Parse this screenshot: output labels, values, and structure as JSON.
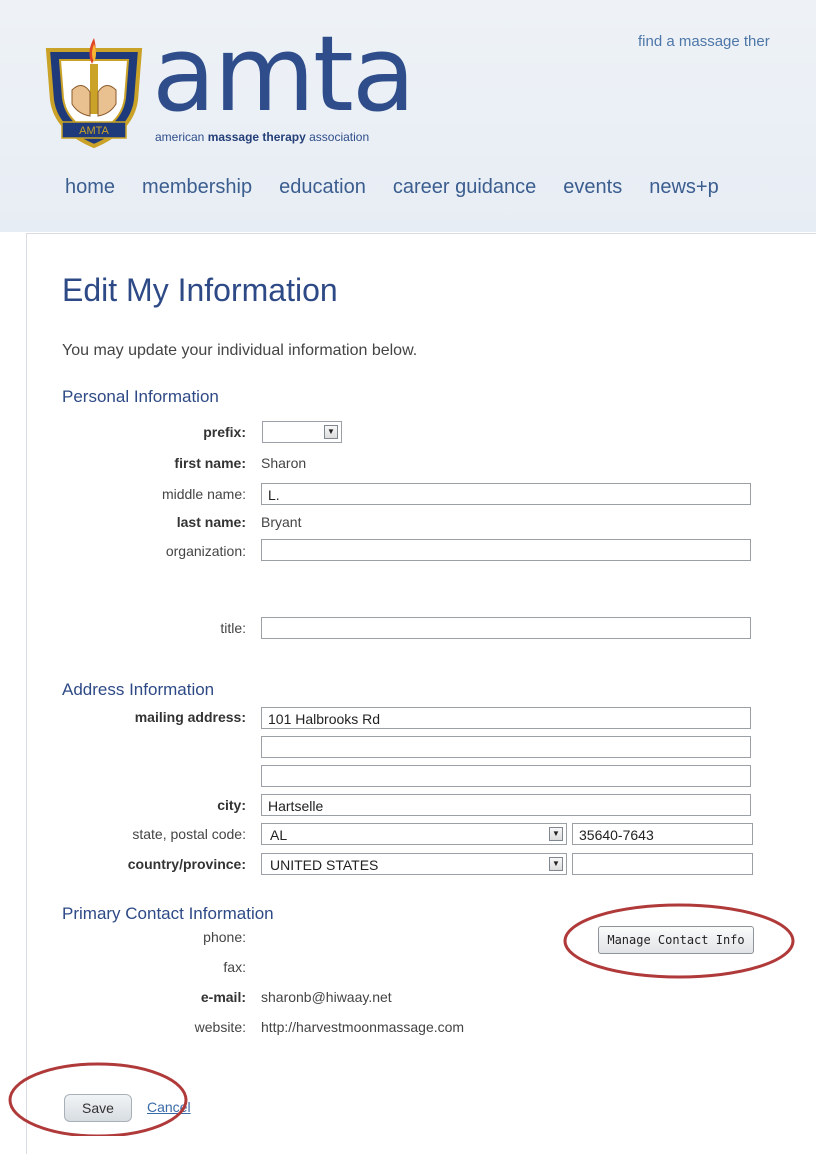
{
  "header": {
    "logo_word": "amta",
    "logo_tagline_pre": "american",
    "logo_tagline_bold": "massage therapy",
    "logo_tagline_post": "association",
    "emblem_text": "AMTA",
    "top_link": "find a massage ther",
    "nav": [
      "home",
      "membership",
      "education",
      "career guidance",
      "events",
      "news+p"
    ]
  },
  "page": {
    "title": "Edit My Information",
    "intro": "You may update your individual information below."
  },
  "personal": {
    "section_title": "Personal Information",
    "prefix_label": "prefix:",
    "prefix_value": "",
    "first_name_label": "first name:",
    "first_name_value": "Sharon",
    "middle_name_label": "middle name:",
    "middle_name_value": "L.",
    "last_name_label": "last name:",
    "last_name_value": "Bryant",
    "organization_label": "organization:",
    "organization_value": "",
    "title_label": "title:",
    "title_value": ""
  },
  "address": {
    "section_title": "Address Information",
    "mailing_label": "mailing address:",
    "line1": "101 Halbrooks Rd",
    "line2": "",
    "line3": "",
    "city_label": "city:",
    "city_value": "Hartselle",
    "state_label": "state, postal code:",
    "state_value": "AL",
    "postal_value": "35640-7643",
    "country_label": "country/province:",
    "country_value": "UNITED STATES",
    "province_value": ""
  },
  "contact": {
    "section_title": "Primary Contact Information",
    "phone_label": "phone:",
    "phone_value": "",
    "fax_label": "fax:",
    "fax_value": "",
    "email_label": "e-mail:",
    "email_value": "sharonb@hiwaay.net",
    "website_label": "website:",
    "website_value": "http://harvestmoonmassage.com",
    "manage_button": "Manage Contact Info"
  },
  "actions": {
    "save": "Save",
    "cancel": "Cancel"
  },
  "colors": {
    "brand_blue": "#2e4a86",
    "link_blue": "#3b6aa8",
    "highlight_red": "#b03a3a"
  }
}
